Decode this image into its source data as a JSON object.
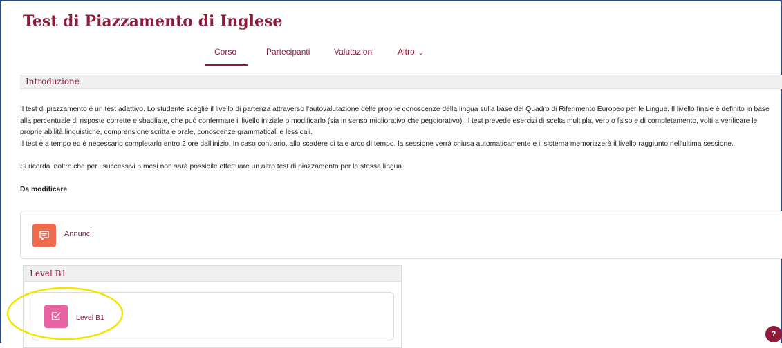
{
  "course": {
    "title": "Test di Piazzamento di Inglese"
  },
  "nav": {
    "items": [
      {
        "label": "Corso"
      },
      {
        "label": "Partecipanti"
      },
      {
        "label": "Valutazioni"
      },
      {
        "label": "Altro"
      }
    ]
  },
  "intro_section": {
    "title": "Introduzione",
    "paragraph1": "Il test di piazzamento è un test adattivo. Lo studente sceglie il livello di partenza attraverso l'autovalutazione delle proprie conoscenze della lingua sulla base del Quadro di Riferimento Europeo per le Lingue. Il livello finale è definito in base alla percentuale di risposte corrette e sbagliate, che può confermare il livello iniziale o modificarlo (sia in senso migliorativo che peggiorativo). Il test prevede esercizi di scelta multipla, vero o falso e di completamento, volti a verificare le proprie abilità linguistiche, comprensione scritta e orale, conoscenze grammaticali e lessicali.",
    "paragraph2": "Il test è a tempo ed è necessario completarlo entro 2 ore dall'inizio. In caso contrario, allo scadere di tale arco di tempo, la sessione verrà chiusa automaticamente e il sistema memorizzerà il livello raggiunto nell'ultima sessione.",
    "paragraph3": "Si ricorda inoltre che per i successivi 6 mesi non sarà possibile effettuare un altro test di piazzamento per la stessa lingua.",
    "note": "Da modificare"
  },
  "activities": {
    "announcements": {
      "label": "Annunci",
      "icon": "forum-icon"
    }
  },
  "level_b1_section": {
    "title": "Level B1",
    "activity": {
      "label": "Level B1",
      "icon": "quiz-icon"
    }
  },
  "help": {
    "label": "?"
  },
  "colors": {
    "brand": "#8f1b3b",
    "forum_icon_bg": "#f06b4e",
    "quiz_icon_bg": "#e863a2",
    "highlight": "#f2e600",
    "frame": "#2b4c8c"
  }
}
